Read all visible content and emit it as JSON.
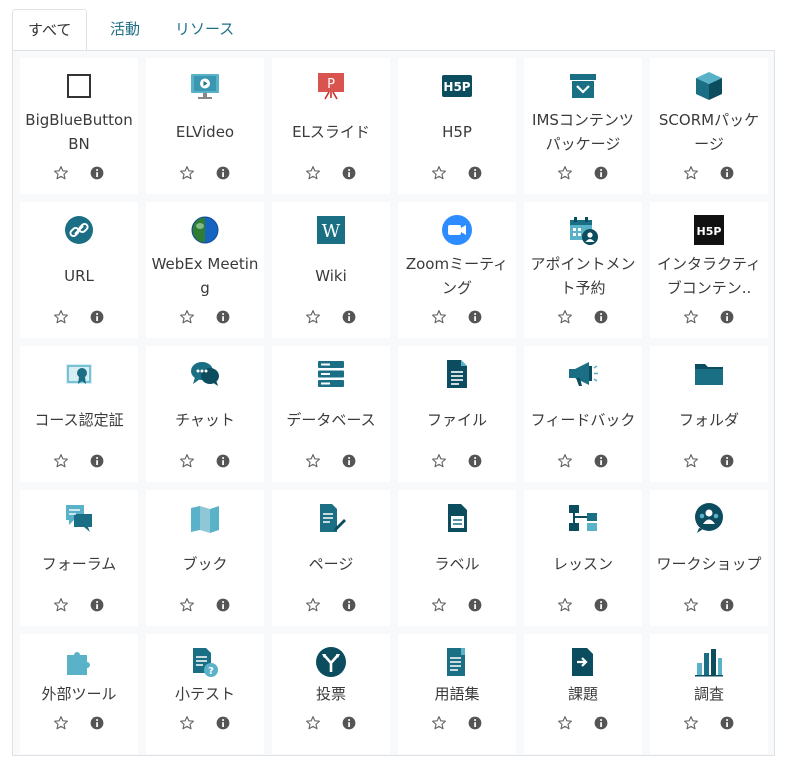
{
  "tabs": [
    {
      "label": "すべて",
      "active": true
    },
    {
      "label": "活動",
      "active": false
    },
    {
      "label": "リソース",
      "active": false
    }
  ],
  "modules": [
    {
      "icon": "bigbluebutton-icon",
      "label": "BigBlueButtonBN"
    },
    {
      "icon": "video-icon",
      "label": "ELVideo"
    },
    {
      "icon": "slide-icon",
      "label": "ELスライド"
    },
    {
      "icon": "h5p-icon",
      "label": "H5P"
    },
    {
      "icon": "ims-package-icon",
      "label": "IMSコンテンツパッケージ"
    },
    {
      "icon": "scorm-package-icon",
      "label": "SCORMパッケージ"
    },
    {
      "icon": "link-icon",
      "label": "URL"
    },
    {
      "icon": "webex-icon",
      "label": "WebEx Meeting"
    },
    {
      "icon": "wiki-icon",
      "label": "Wiki"
    },
    {
      "icon": "zoom-icon",
      "label": "Zoomミーティング"
    },
    {
      "icon": "calendar-person-icon",
      "label": "アポイントメント予約"
    },
    {
      "icon": "h5p-interactive-icon",
      "label": "インタラクティブコンテン.."
    },
    {
      "icon": "certificate-icon",
      "label": "コース認定証"
    },
    {
      "icon": "chat-icon",
      "label": "チャット"
    },
    {
      "icon": "database-icon",
      "label": "データベース"
    },
    {
      "icon": "file-icon",
      "label": "ファイル"
    },
    {
      "icon": "megaphone-icon",
      "label": "フィードバック"
    },
    {
      "icon": "folder-icon",
      "label": "フォルダ"
    },
    {
      "icon": "forum-icon",
      "label": "フォーラム"
    },
    {
      "icon": "book-icon",
      "label": "ブック"
    },
    {
      "icon": "page-icon",
      "label": "ページ"
    },
    {
      "icon": "label-icon",
      "label": "ラベル"
    },
    {
      "icon": "lesson-icon",
      "label": "レッスン"
    },
    {
      "icon": "workshop-icon",
      "label": "ワークショップ"
    },
    {
      "icon": "puzzle-icon",
      "label": "外部ツール"
    },
    {
      "icon": "quiz-icon",
      "label": "小テスト"
    },
    {
      "icon": "choice-icon",
      "label": "投票"
    },
    {
      "icon": "glossary-icon",
      "label": "用語集"
    },
    {
      "icon": "assignment-icon",
      "label": "課題"
    },
    {
      "icon": "survey-icon",
      "label": "調査"
    }
  ],
  "colors": {
    "tab_link": "#1f6f86",
    "icon_teal": "#1b6f84",
    "icon_dark": "#0b4c5f",
    "icon_light": "#5ab2c9",
    "action_icon": "#555555"
  },
  "action_icons": [
    "star-outline-icon",
    "info-circle-icon"
  ]
}
